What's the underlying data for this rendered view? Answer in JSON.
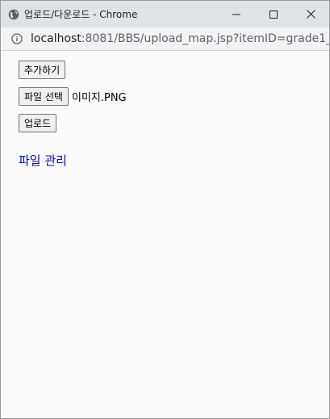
{
  "window": {
    "title": "업로드/다운로드 - Chrome",
    "icons": {
      "favicon": "globe-icon",
      "minimize": "minimize-icon",
      "maximize": "maximize-icon",
      "close": "close-icon"
    }
  },
  "addressbar": {
    "host": "localhost",
    "path": ":8081/BBS/upload_map.jsp?itemID=grade1_i...",
    "icon": "info-icon"
  },
  "main": {
    "add_button": "추가하기",
    "file_select_button": "파일 선택",
    "selected_file": "이미지.PNG",
    "upload_button": "업로드",
    "file_manage_link": "파일 관리"
  },
  "colors": {
    "link": "#0000ee",
    "titlebar": "#dfe3e8",
    "page_bg": "#fafafa"
  }
}
